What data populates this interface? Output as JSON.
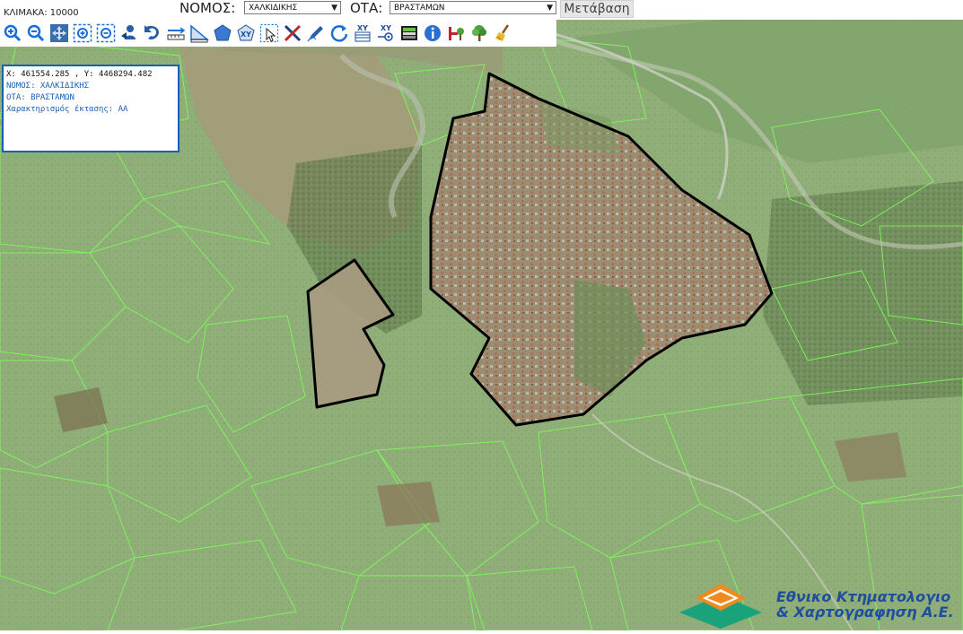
{
  "header": {
    "scale_label": "ΚΛΙΜΑΚΑ: 10000",
    "nomos_label": "ΝΟΜΟΣ:",
    "nomos_value": "ΧΑΛΚΙΔΙΚΗΣ",
    "ota_label": "ΟΤΑ:",
    "ota_value": "ΒΡΑΣΤΑΜΩΝ",
    "go_button": "Μετάβαση"
  },
  "toolbar": {
    "tools": [
      "zoom-in-icon",
      "zoom-out-icon",
      "pan-icon",
      "zoom-box-in-icon",
      "zoom-box-out-icon",
      "identify-person-icon",
      "previous-extent-icon",
      "measure-distance-icon",
      "measure-area-icon",
      "polygon-icon",
      "xy-icon",
      "select-icon",
      "clear-icon",
      "draw-icon",
      "refresh-icon",
      "xy-table-icon",
      "xy-goto-icon",
      "legend-icon",
      "info-icon",
      "tree-red-icon",
      "tree-green-icon",
      "broom-icon"
    ],
    "xy_text": "XY"
  },
  "info_panel": {
    "coords": "X: 461554.285 , Y: 4468294.482",
    "nomos": "ΝΟΜΟΣ: ΧΑΛΚΙΔΙΚΗΣ",
    "ota": "ΟΤΑ: ΒΡΑΣΤΑΜΩΝ",
    "characterization": "Χαρακτηρισμός έκτασης: ΑΑ"
  },
  "logo": {
    "line1": "Εθνικο Κτηματολογιο",
    "line2": "& Χαρτογραφηση Α.Ε."
  },
  "colors": {
    "accent": "#1a5fb4",
    "parcel_outline": "#7dff5a",
    "boundary": "#000000",
    "logo_orange": "#f08a1c",
    "logo_teal": "#1aa37a"
  }
}
